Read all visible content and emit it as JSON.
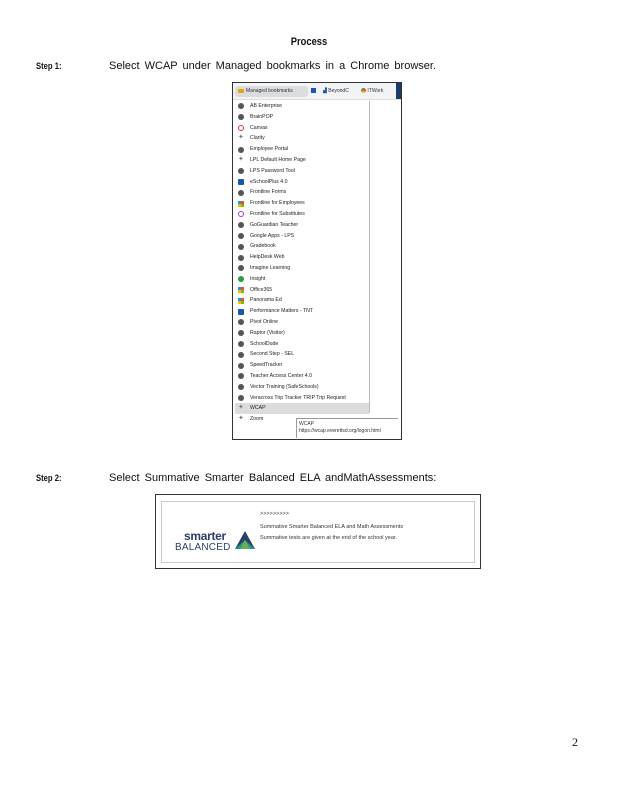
{
  "page_title": "Process",
  "steps": [
    {
      "label": "Step 1:",
      "text": "Select WCAP under Managed bookmarks in a Chrome browser."
    },
    {
      "label": "Step 2:",
      "text": "Select Summative Smarter Balanced ELA andMathAssessments:"
    }
  ],
  "bookmarks_bar": {
    "managed_label": "Managed bookmarks",
    "chip2": "BeyondC",
    "chip3": "ITWork"
  },
  "menu_items": [
    "AB Enterprise",
    "BrainPOP",
    "Canvas",
    "Clarity",
    "Employee Portal",
    "LPL Default Home Page",
    "LPS Password Tool",
    "eSchoolPlus 4.0",
    "Frontline Forms",
    "Frontline for Employees",
    "Frontline for Substitutes",
    "GoGuardian Teacher",
    "Google Apps - LPS",
    "Gradebook",
    "HelpDesk Web",
    "Imagine Learning",
    "Insight",
    "Office365",
    "Panorama Ed",
    "Performance Matters - TNT",
    "Pivot Online",
    "Raptor (Visitor)",
    "SchoolDude",
    "Second Step - SEL",
    "SpeedTracker",
    "Teacher Access Center 4.0",
    "Vector Training (SafeSchools)",
    "Veracross Trip Tracker TRIP Trip Request",
    "WCAP",
    "Zoom"
  ],
  "selected_item": "WCAP",
  "tooltip": {
    "title": "WCAP",
    "url": "https://wcap.everettsd.org/logon.html"
  },
  "smarter_balanced": {
    "logo_top": "smarter",
    "logo_bottom": "BALANCED",
    "dots": ">>>>>>>>>",
    "title": "Summative Smarter Balanced ELA and Math Assessments",
    "desc": "Summative tests are given at the end of the school year."
  },
  "page_number": "2",
  "colors": {
    "sb_navy": "#2c3e6a",
    "sb_teal": "#1a9a8a",
    "sb_green": "#6ab04c",
    "selection": "#dcdcdc"
  }
}
